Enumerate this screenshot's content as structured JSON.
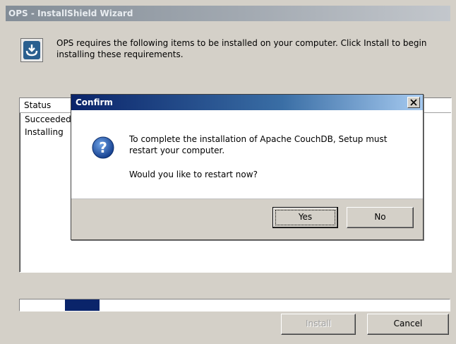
{
  "wizard": {
    "title": "OPS - InstallShield Wizard",
    "icon": "installer-icon",
    "intro_text": "OPS requires the following items to be installed on your computer. Click Install to begin installing these requirements.",
    "status_header": "Status",
    "rows": [
      {
        "status": "Succeeded"
      },
      {
        "status": "Installing"
      }
    ],
    "progress_fraction": 0.1,
    "install_label": "Install",
    "cancel_label": "Cancel"
  },
  "confirm": {
    "title": "Confirm",
    "close_icon": "close-icon",
    "question_icon": "question-icon",
    "message": "To complete the installation of Apache CouchDB, Setup must restart your computer.",
    "question": "Would you like to restart now?",
    "yes_label": "Yes",
    "no_label": "No"
  },
  "colors": {
    "confirm_title_start": "#0a246a",
    "wizard_title_start": "#838d97",
    "progress_fill": "#0a246a",
    "dialog_face": "#d4d0c8"
  }
}
